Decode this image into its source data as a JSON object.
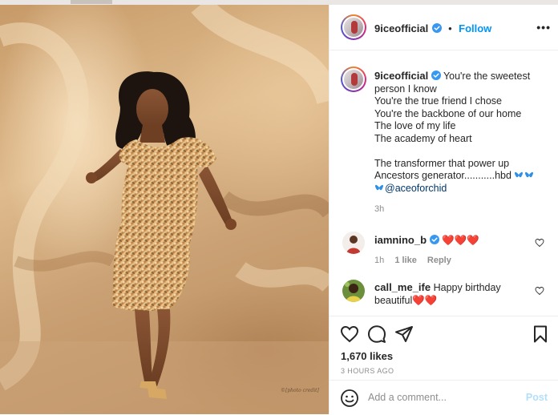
{
  "post": {
    "username": "9iceofficial",
    "follow_label": "Follow",
    "separator": "•",
    "more_label": "•••",
    "caption": {
      "first_line": "You're the sweetest",
      "body": "person I know\nYou're the true friend I chose\nYou're the backbone of our home\nThe love of my life\nThe academy of heart\n\nThe transformer that power up\nAncestors generator...........hbd",
      "mention": "@aceoforchid",
      "age": "3h"
    },
    "comments": [
      {
        "username": "iamnino_b",
        "verified": true,
        "text": "",
        "emoji": "❤️❤️❤️",
        "age": "1h",
        "likes": "1 like",
        "reply_label": "Reply"
      },
      {
        "username": "call_me_ife",
        "verified": false,
        "text": "Happy birthday",
        "text2": "beautiful",
        "emoji": "❤️❤️",
        "age": "",
        "likes": "",
        "reply_label": ""
      }
    ],
    "likes": "1,670 likes",
    "posted_ago": "3 HOURS AGO",
    "add_comment_placeholder": "Add a comment...",
    "post_label": "Post",
    "photo_watermark": "©[photo credit]",
    "icons": {
      "like": "heart-icon",
      "comment": "comment-bubble-icon",
      "share": "paper-plane-icon",
      "save": "bookmark-icon",
      "emoji": "smiley-icon",
      "verified": "verified-badge-icon"
    },
    "colors": {
      "link_blue": "#0095f6",
      "verified_blue": "#3897f0",
      "text": "#262626",
      "muted": "#8e8e8e",
      "heart_red": "#ed4956",
      "butterfly_blue": "#2d8fe6"
    }
  }
}
